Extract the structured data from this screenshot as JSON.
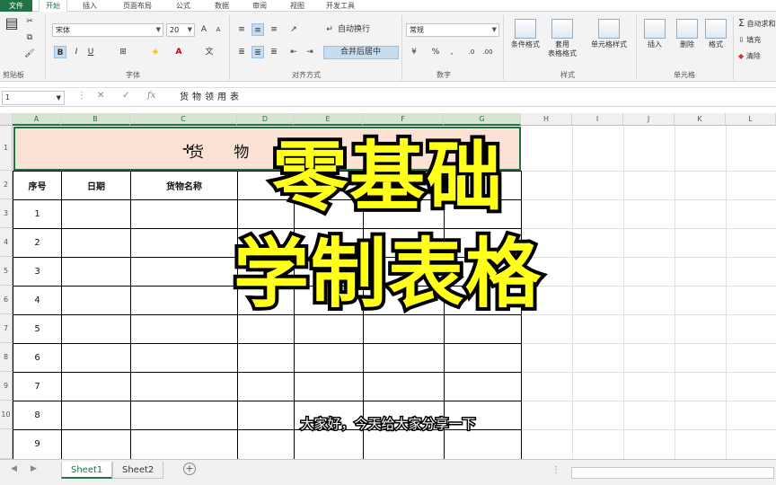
{
  "ribbon_tabs": [
    "文件",
    "开始",
    "插入",
    "页面布局",
    "公式",
    "数据",
    "审阅",
    "视图",
    "开发工具"
  ],
  "ribbon": {
    "font_name": "宋体",
    "font_size": "20",
    "wrap_label": "自动换行",
    "merge_label": "合并后居中",
    "number_format": "常规",
    "cond_format": "条件格式",
    "table_format": "套用\n表格格式",
    "cell_style": "单元格样式",
    "insert": "插入",
    "delete": "删除",
    "format": "格式",
    "autosum": "自动求和",
    "fill": "填充",
    "clear": "清除",
    "groups": {
      "clipboard": "剪贴板",
      "font": "字体",
      "align": "对齐方式",
      "number": "数字",
      "styles": "样式",
      "cells": "单元格"
    }
  },
  "formula_bar": {
    "name_box": "1",
    "content": "货物领用表"
  },
  "columns": [
    "A",
    "B",
    "C",
    "D",
    "E",
    "F",
    "G",
    "H",
    "I",
    "J",
    "K",
    "L"
  ],
  "row_numbers": [
    "1",
    "2",
    "3",
    "4",
    "5",
    "6",
    "7",
    "8",
    "9",
    "10"
  ],
  "table": {
    "title": "货 物",
    "headers": [
      "序号",
      "日期",
      "货物名称"
    ],
    "serials": [
      "1",
      "2",
      "3",
      "4",
      "5",
      "6",
      "7",
      "8",
      "9"
    ]
  },
  "overlay": {
    "line1": "零基础",
    "line2": "学制表格",
    "color": "#ffff1a"
  },
  "subtitle": "大家好，今天给大家分享一下",
  "sheets": [
    "Sheet1",
    "Sheet2"
  ],
  "accent": "#217346"
}
